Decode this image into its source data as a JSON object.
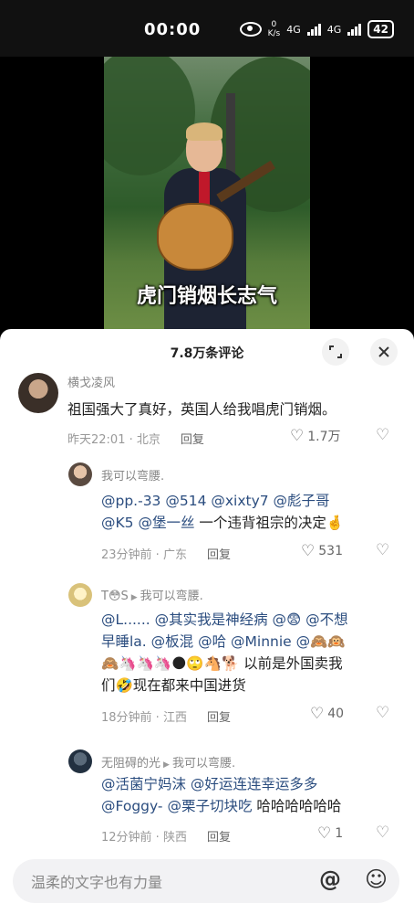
{
  "status": {
    "time": "00:00",
    "net_speed": "0",
    "net_unit": "K/s",
    "sig1": "4G",
    "sig2": "4G",
    "battery": "42"
  },
  "video": {
    "subtitle": "虎门销烟长志气"
  },
  "sheet": {
    "title": "7.8万条评论"
  },
  "comments": [
    {
      "name": "横戈凌风",
      "text": "祖国强大了真好，英国人给我唱虎门销烟。",
      "time": "昨天22:01",
      "location": "北京",
      "reply": "回复",
      "likes": "1.7万"
    },
    {
      "name": "我可以弯腰.",
      "text_mentions": "@pp.-33 @514 @xixty7 @彪子哥",
      "text_line2_mentions": "@K5 @堡一丝",
      "text_line2_rest": " 一个违背祖宗的决定🤞",
      "time": "23分钟前",
      "location": "广东",
      "reply": "回复",
      "likes": "531"
    },
    {
      "name": "T😳S",
      "reply_to": "我可以弯腰.",
      "line1": "@L...... @其实我是神经病 @😨 @不想",
      "line2": "早睡la. @板混 @哈 @Minnie @🙈🙉",
      "line3": "🙈🦄🦄🦄🌑🙄🐴🐕 以前是外国卖我",
      "line4": "们🤣现在都来中国进货",
      "time": "18分钟前",
      "location": "江西",
      "reply": "回复",
      "likes": "40"
    },
    {
      "name": "无阻碍的光",
      "reply_to": "我可以弯腰.",
      "line1": "@活菌宁妈沫 @好运连连幸运多多",
      "line2_mentions": "@Foggy- @栗子切块吃",
      "line2_rest": " 哈哈哈哈哈哈",
      "time": "12分钟前",
      "location": "陕西",
      "reply": "回复",
      "likes": "1"
    }
  ],
  "input": {
    "placeholder": "温柔的文字也有力量"
  },
  "icons": {
    "expand": "expand-icon",
    "close": "close-icon",
    "heart": "heart-icon",
    "dislike": "broken-heart-icon",
    "at": "at-icon",
    "emoji": "emoji-icon"
  }
}
